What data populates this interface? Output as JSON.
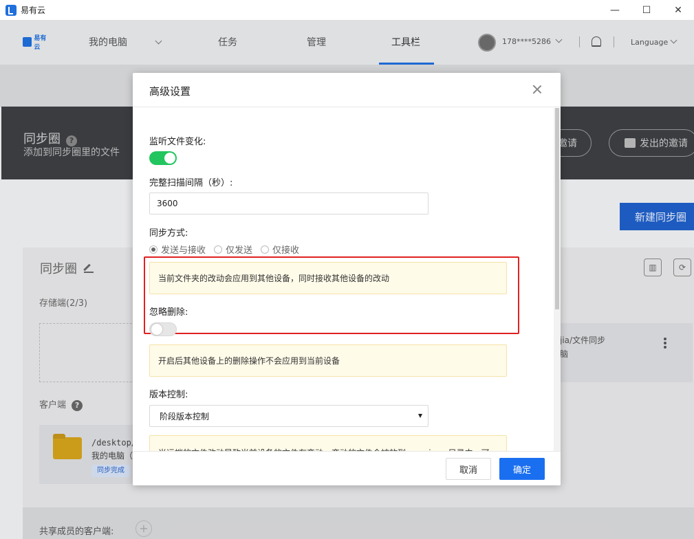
{
  "window": {
    "title": "易有云",
    "controls": {
      "minimize": "—",
      "maximize": "☐",
      "close": "✕"
    }
  },
  "nav": {
    "brand": "易有云",
    "items": [
      "我的电脑",
      "任务",
      "管理",
      "工具栏"
    ],
    "active_index": 3,
    "phone": "178****5286",
    "language": "Language"
  },
  "background": {
    "hero_title": "同步圈",
    "hero_subtitle": "添加到同步圈里的文件",
    "invite_received": "邀请",
    "invite_sent": "发出的邀请",
    "new_button": "新建同步圈",
    "panel_title": "同步圈",
    "storage_label": "存储端(2/3)",
    "card_right_line1": "jia/文件同步",
    "card_right_line2": "脑",
    "client_label": "客户端",
    "client_path": "/desktop/文",
    "client_device": "我的电脑（",
    "client_status": "同步完成",
    "share_label": "共享成员的客户端:",
    "help": "?"
  },
  "modal": {
    "title": "高级设置",
    "watch_label": "监听文件变化:",
    "watch_enabled": true,
    "scan_label": "完整扫描间隔（秒）:",
    "scan_value": "3600",
    "sync_mode_label": "同步方式:",
    "sync_modes": [
      "发送与接收",
      "仅发送",
      "仅接收"
    ],
    "sync_mode_selected": 0,
    "sync_mode_note": "当前文件夹的改动会应用到其他设备，同时接收其他设备的改动",
    "ignore_delete_label": "忽略删除:",
    "ignore_delete_enabled": false,
    "ignore_delete_note": "开启后其他设备上的删除操作不会应用到当前设备",
    "version_label": "版本控制:",
    "version_value": "阶段版本控制",
    "version_note": "当远端的文件改动导致当前设备的文件有变动，变动的文件会被放到 .versions 目录中，可",
    "cancel": "取消",
    "ok": "确定"
  },
  "colors": {
    "accent": "#1a6ff0",
    "toggle_on": "#22c55e",
    "highlight": "#e02020",
    "note_bg": "#fffbe9"
  }
}
